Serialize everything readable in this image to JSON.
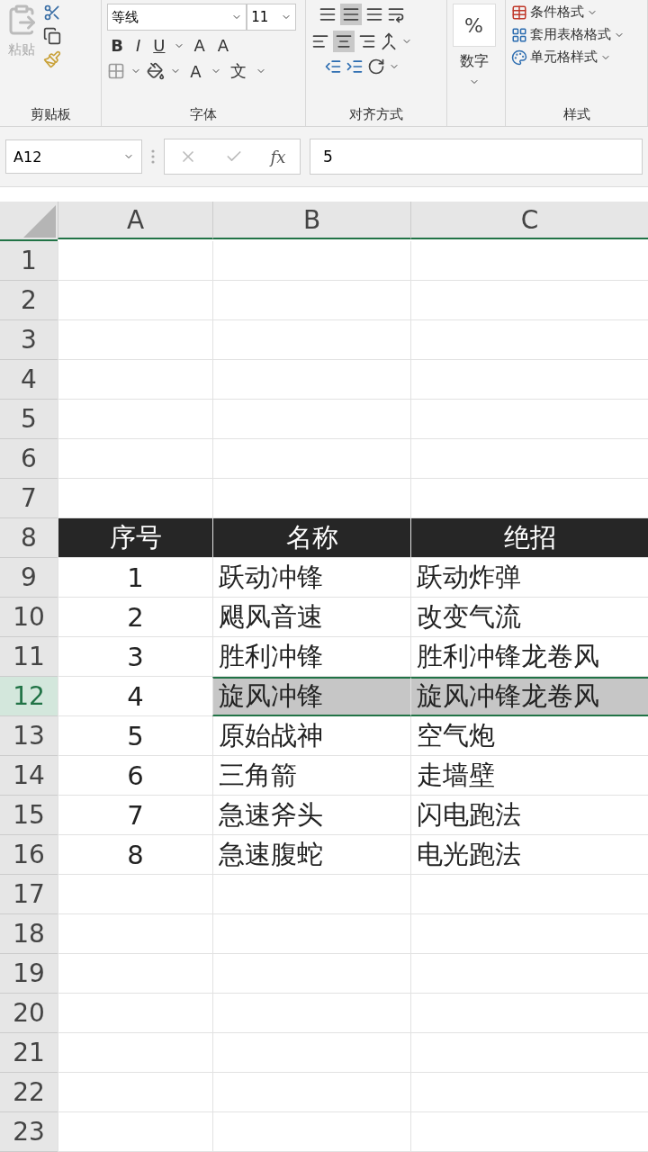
{
  "ribbon": {
    "clipboard": {
      "paste": "粘贴",
      "label": "剪贴板"
    },
    "font": {
      "name": "等线",
      "size": "11",
      "bold": "B",
      "italic": "I",
      "underline": "U",
      "grow": "A",
      "shrink": "A",
      "font_color_letter": "A",
      "phonetic": "文",
      "label": "字体"
    },
    "alignment": {
      "label": "对齐方式"
    },
    "number": {
      "symbol": "%",
      "label": "数字"
    },
    "styles": {
      "items": [
        "条件格式",
        "套用表格格式",
        "单元格样式"
      ],
      "label": "样式"
    }
  },
  "formula_bar": {
    "name_box": "A12",
    "fx": "fx",
    "value": "5"
  },
  "columns": [
    "A",
    "B",
    "C"
  ],
  "rows": [
    {
      "number": "1",
      "kind": "blank",
      "selected": false
    },
    {
      "number": "2",
      "kind": "blank",
      "selected": false
    },
    {
      "number": "3",
      "kind": "blank",
      "selected": false
    },
    {
      "number": "4",
      "kind": "blank",
      "selected": false
    },
    {
      "number": "5",
      "kind": "blank",
      "selected": false
    },
    {
      "number": "6",
      "kind": "blank",
      "selected": false
    },
    {
      "number": "7",
      "kind": "blank",
      "selected": false
    },
    {
      "number": "8",
      "kind": "header",
      "selected": false,
      "cells": [
        "序号",
        "名称",
        "绝招"
      ]
    },
    {
      "number": "9",
      "kind": "data",
      "selected": false,
      "cells": [
        "1",
        "跃动冲锋",
        "跃动炸弹"
      ]
    },
    {
      "number": "10",
      "kind": "data",
      "selected": false,
      "cells": [
        "2",
        "飓风音速",
        "改变气流"
      ]
    },
    {
      "number": "11",
      "kind": "data",
      "selected": false,
      "cells": [
        "3",
        "胜利冲锋",
        "胜利冲锋龙卷风"
      ]
    },
    {
      "number": "12",
      "kind": "data",
      "selected": true,
      "cells": [
        "4",
        "旋风冲锋",
        "旋风冲锋龙卷风"
      ]
    },
    {
      "number": "13",
      "kind": "data",
      "selected": false,
      "cells": [
        "5",
        "原始战神",
        "空气炮"
      ]
    },
    {
      "number": "14",
      "kind": "data",
      "selected": false,
      "cells": [
        "6",
        "三角箭",
        "走墙壁"
      ]
    },
    {
      "number": "15",
      "kind": "data",
      "selected": false,
      "cells": [
        "7",
        "急速斧头",
        "闪电跑法"
      ]
    },
    {
      "number": "16",
      "kind": "data",
      "selected": false,
      "cells": [
        "8",
        "急速腹蛇",
        "电光跑法"
      ]
    },
    {
      "number": "17",
      "kind": "blank",
      "selected": false
    },
    {
      "number": "18",
      "kind": "blank",
      "selected": false
    },
    {
      "number": "19",
      "kind": "blank",
      "selected": false
    },
    {
      "number": "20",
      "kind": "blank",
      "selected": false
    },
    {
      "number": "21",
      "kind": "blank",
      "selected": false
    },
    {
      "number": "22",
      "kind": "blank",
      "selected": false
    },
    {
      "number": "23",
      "kind": "blank",
      "selected": false
    }
  ]
}
